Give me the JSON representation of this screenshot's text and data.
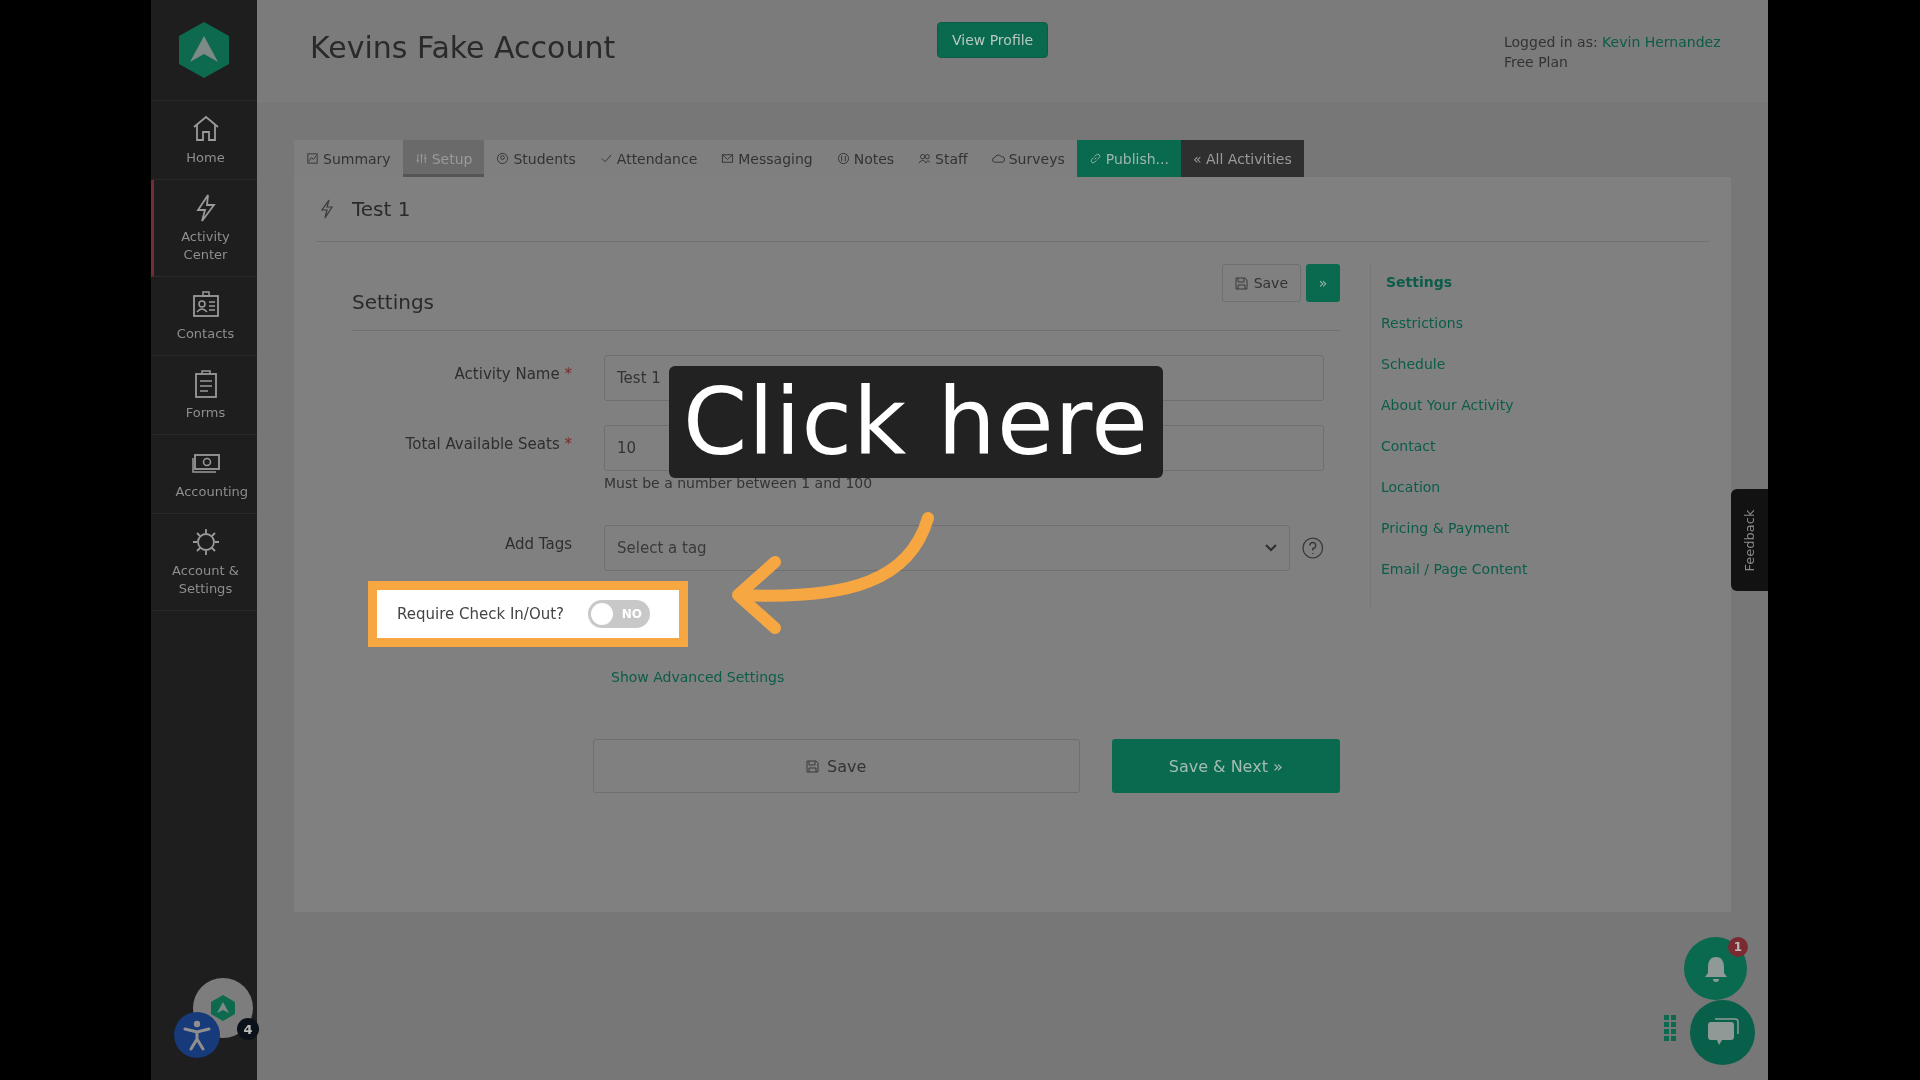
{
  "sidebar": {
    "items": [
      {
        "label": "Home",
        "selected": false
      },
      {
        "label": "Activity Center",
        "selected": true
      },
      {
        "label": "Contacts",
        "selected": false
      },
      {
        "label": "Forms",
        "selected": false
      },
      {
        "label": "Accounting",
        "selected": false
      },
      {
        "label": "Account & Settings",
        "selected": false
      }
    ],
    "support_badge": "4"
  },
  "header": {
    "title": "Kevins Fake Account",
    "profile_button": "View Profile",
    "login_label": "Logged in as:",
    "user": "Kevin Hernandez",
    "plan": "Free Plan"
  },
  "tabs": [
    {
      "label": "Summary",
      "selected": false,
      "kind": "plain"
    },
    {
      "label": "Setup",
      "selected": true,
      "kind": "plain"
    },
    {
      "label": "Students",
      "selected": false,
      "kind": "plain"
    },
    {
      "label": "Attendance",
      "selected": false,
      "kind": "plain"
    },
    {
      "label": "Messaging",
      "selected": false,
      "kind": "plain"
    },
    {
      "label": "Notes",
      "selected": false,
      "kind": "plain"
    },
    {
      "label": "Staff",
      "selected": false,
      "kind": "plain"
    },
    {
      "label": "Surveys",
      "selected": false,
      "kind": "plain"
    },
    {
      "label": "Publish...",
      "selected": false,
      "kind": "publish"
    },
    {
      "label": "« All Activities",
      "selected": false,
      "kind": "back"
    }
  ],
  "activity": {
    "title": "Test 1"
  },
  "settings": {
    "heading": "Settings",
    "save_button": "Save",
    "next_button": "»",
    "fields": [
      {
        "kind": "text",
        "label": "Activity Name",
        "required_mark": "*",
        "value": "Test 1"
      },
      {
        "kind": "text",
        "label": "Total Available Seats",
        "required_mark": "*",
        "value": "10",
        "hint": "Must be a number between 1 and 100"
      },
      {
        "kind": "select",
        "label": "Add Tags",
        "placeholder": "Select a tag"
      }
    ],
    "toggle": {
      "label": "Require Check In/Out?",
      "on": false,
      "text": "NO"
    },
    "advanced_link": "Show Advanced Settings",
    "save": "Save",
    "save_next": "Save & Next »"
  },
  "section_nav": [
    {
      "label": "Settings",
      "selected": true
    },
    {
      "label": "Restrictions",
      "selected": false
    },
    {
      "label": "Schedule",
      "selected": false
    },
    {
      "label": "About Your Activity",
      "selected": false
    },
    {
      "label": "Contact",
      "selected": false
    },
    {
      "label": "Location",
      "selected": false
    },
    {
      "label": "Pricing & Payment",
      "selected": false
    },
    {
      "label": "Email / Page Content",
      "selected": false
    }
  ],
  "feedback": "Feedback",
  "notifications": {
    "badge": "1"
  },
  "callout": {
    "text": "Click here"
  }
}
